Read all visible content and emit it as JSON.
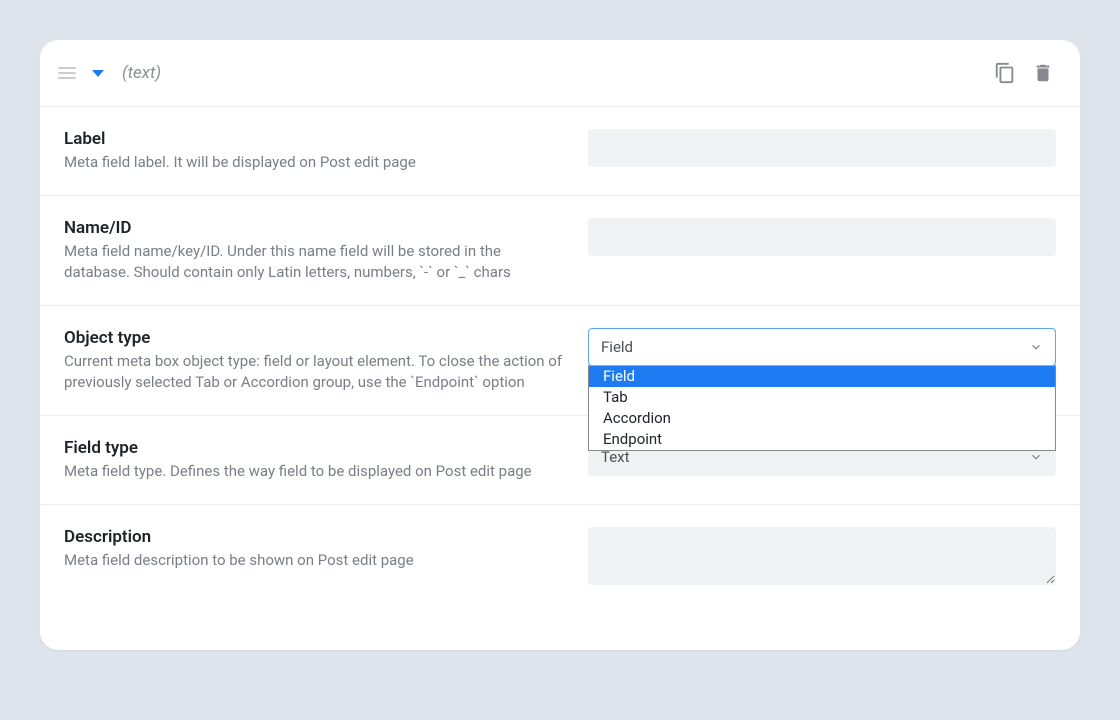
{
  "header": {
    "title": "(text)"
  },
  "rows": {
    "label": {
      "title": "Label",
      "desc": "Meta field label. It will be displayed on Post edit page",
      "value": ""
    },
    "name_id": {
      "title": "Name/ID",
      "desc": "Meta field name/key/ID. Under this name field will be stored in the database. Should contain only Latin letters, numbers, `-` or `_` chars",
      "value": ""
    },
    "object_type": {
      "title": "Object type",
      "desc": "Current meta box object type: field or layout element. To close the action of previously selected Tab or Accordion group, use the `Endpoint` option",
      "selected": "Field",
      "options": [
        "Field",
        "Tab",
        "Accordion",
        "Endpoint"
      ]
    },
    "field_type": {
      "title": "Field type",
      "desc": "Meta field type. Defines the way field to be displayed on Post edit page",
      "selected": "Text"
    },
    "description": {
      "title": "Description",
      "desc": "Meta field description to be shown on Post edit page",
      "value": ""
    }
  }
}
